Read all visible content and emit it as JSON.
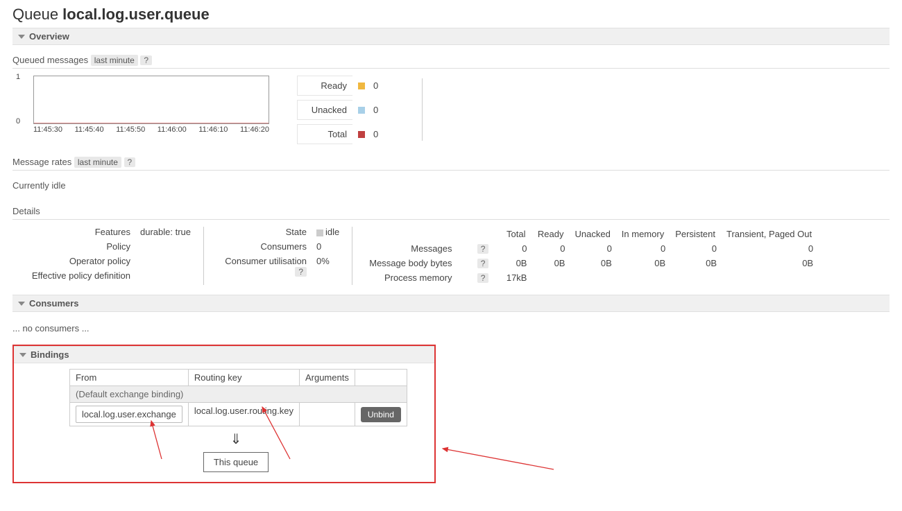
{
  "header": {
    "prefix": "Queue ",
    "name": "local.log.user.queue"
  },
  "sections": {
    "overview": "Overview",
    "consumers": "Consumers",
    "bindings": "Bindings"
  },
  "queued_messages": {
    "label": "Queued messages",
    "window": "last minute",
    "help": "?"
  },
  "chart_data": {
    "type": "line",
    "x": [
      "11:45:30",
      "11:45:40",
      "11:45:50",
      "11:46:00",
      "11:46:10",
      "11:46:20"
    ],
    "series": [
      {
        "name": "Ready",
        "values": [
          0,
          0,
          0,
          0,
          0,
          0
        ],
        "color": "#f0b840"
      },
      {
        "name": "Unacked",
        "values": [
          0,
          0,
          0,
          0,
          0,
          0
        ],
        "color": "#a8d0e8"
      },
      {
        "name": "Total",
        "values": [
          0,
          0,
          0,
          0,
          0,
          0
        ],
        "color": "#c04040"
      }
    ],
    "ylim": [
      0.0,
      1.0
    ],
    "xlabel": "",
    "ylabel": "",
    "title": ""
  },
  "legend": {
    "ready": {
      "label": "Ready",
      "value": "0",
      "color": "#f0b840"
    },
    "unacked": {
      "label": "Unacked",
      "value": "0",
      "color": "#a8d0e8"
    },
    "total": {
      "label": "Total",
      "value": "0",
      "color": "#c04040"
    }
  },
  "message_rates": {
    "label": "Message rates",
    "window": "last minute",
    "help": "?"
  },
  "idle_text": "Currently idle",
  "details_label": "Details",
  "details_left": {
    "features_lbl": "Features",
    "features_val": "durable: true",
    "policy_lbl": "Policy",
    "policy_val": "",
    "op_policy_lbl": "Operator policy",
    "op_policy_val": "",
    "eff_policy_lbl": "Effective policy definition",
    "eff_policy_val": ""
  },
  "details_mid": {
    "state_lbl": "State",
    "state_val": "idle",
    "consumers_lbl": "Consumers",
    "consumers_val": "0",
    "util_lbl": "Consumer utilisation",
    "util_help": "?",
    "util_val": "0%"
  },
  "stats_table": {
    "headers": [
      "Total",
      "Ready",
      "Unacked",
      "In memory",
      "Persistent",
      "Transient, Paged Out"
    ],
    "rows": [
      {
        "label": "Messages",
        "help": "?",
        "values": [
          "0",
          "0",
          "0",
          "0",
          "0",
          "0"
        ]
      },
      {
        "label": "Message body bytes",
        "help": "?",
        "values": [
          "0B",
          "0B",
          "0B",
          "0B",
          "0B",
          "0B"
        ]
      },
      {
        "label": "Process memory",
        "help": "?",
        "values": [
          "17kB",
          "",
          "",
          "",
          "",
          ""
        ]
      }
    ]
  },
  "consumers_empty": "... no consumers ...",
  "bindings_table": {
    "headers": {
      "from": "From",
      "routing": "Routing key",
      "args": "Arguments"
    },
    "default_row": "(Default exchange binding)",
    "rows": [
      {
        "from": "local.log.user.exchange",
        "routing": "local.log.user.routing.key",
        "args": "",
        "unbind": "Unbind"
      }
    ]
  },
  "flow_arrow": "⇓",
  "this_queue_label": "This queue"
}
